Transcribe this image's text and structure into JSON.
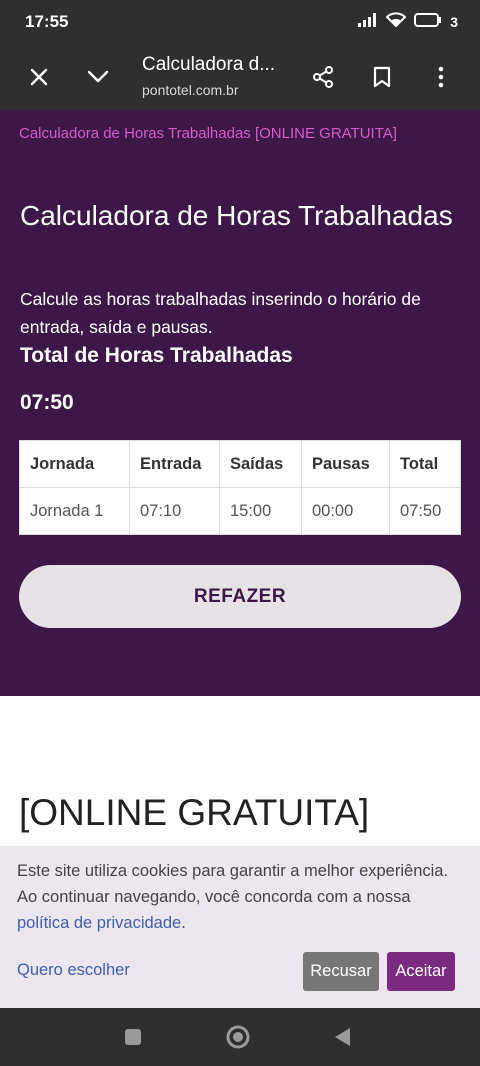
{
  "status_bar": {
    "time": "17:55",
    "battery": "3"
  },
  "browser": {
    "title": "Calculadora d...",
    "url": "pontotel.com.br"
  },
  "hero": {
    "breadcrumb": "Calculadora de Horas Trabalhadas [ONLINE GRATUITA]",
    "title": "Calculadora de Horas Trabalhadas",
    "subtitle": "Calcule as horas trabalhadas inserindo o horário de entrada, saída e pausas.",
    "total_label": "Total de Horas Trabalhadas",
    "total_value": "07:50"
  },
  "table": {
    "headers": [
      "Jornada",
      "Entrada",
      "Saídas",
      "Pausas",
      "Total"
    ],
    "rows": [
      [
        "Jornada 1",
        "07:10",
        "15:00",
        "00:00",
        "07:50"
      ]
    ]
  },
  "redo_button": "REFAZER",
  "section_heading": "[ONLINE GRATUITA]",
  "cookie": {
    "text_before": "Este site utiliza cookies para garantir a melhor experiência. Ao continuar navegando, você concorda com a nossa ",
    "link_text": "política de privacidade",
    "text_after": ".",
    "choose_label": "Quero escolher",
    "refuse_label": "Recusar",
    "accept_label": "Aceitar"
  },
  "colors": {
    "hero_bg": "#3d1747",
    "breadcrumb": "#d75bc8",
    "accent": "#7a2b7f",
    "link": "#3f5fb0"
  },
  "icons": {
    "browser": [
      "close-icon",
      "chevron-down-icon",
      "share-icon",
      "bookmark-icon",
      "more-vert-icon"
    ],
    "status": [
      "signal-icon",
      "wifi-icon",
      "battery-icon"
    ],
    "nav": [
      "recents-icon",
      "home-icon",
      "back-icon"
    ]
  }
}
